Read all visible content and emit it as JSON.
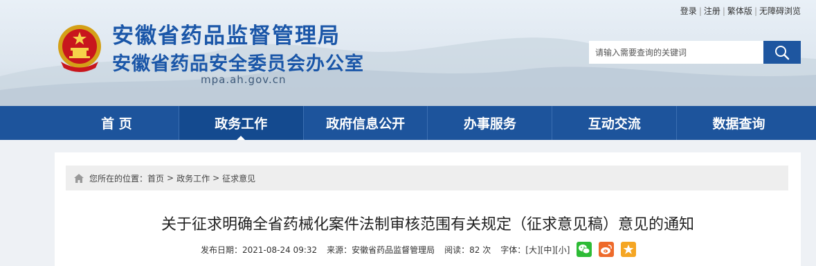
{
  "top_links": {
    "login": "登录",
    "register": "注册",
    "traditional": "繁体版",
    "accessible": "无障碍浏览",
    "separator": "|"
  },
  "site": {
    "title_line1": "安徽省药品监督管理局",
    "title_line2": "安徽省药品安全委员会办公室",
    "domain": "mpa.ah.gov.cn"
  },
  "search": {
    "placeholder": "请输入需要查询的关键词",
    "icon": "search-icon"
  },
  "nav": {
    "items": [
      "首 页",
      "政务工作",
      "政府信息公开",
      "办事服务",
      "互动交流",
      "数据查询"
    ],
    "active_index": 1
  },
  "breadcrumb": {
    "prefix": "您所在的位置：",
    "items": [
      "首页",
      "政务工作",
      "征求意见"
    ],
    "separator": ">"
  },
  "article": {
    "title": "关于征求明确全省药械化案件法制审核范围有关规定（征求意见稿）意见的通知",
    "publish_date": "发布日期：2021-08-24 09:32",
    "source": "来源：安徽省药品监督管理局",
    "reads": "阅读：82 次",
    "font_label": "字体：",
    "font_large": "[大]",
    "font_medium": "[中]",
    "font_small": "[小]"
  },
  "share": {
    "wechat": "wechat-icon",
    "weibo": "weibo-icon",
    "favorite": "favorite-star-icon"
  },
  "colors": {
    "brand_blue": "#1d549c",
    "nav_active": "#144a8f",
    "wechat_green": "#2dbb35",
    "weibo_orange": "#ee6a2b",
    "star_orange": "#f5a623"
  }
}
